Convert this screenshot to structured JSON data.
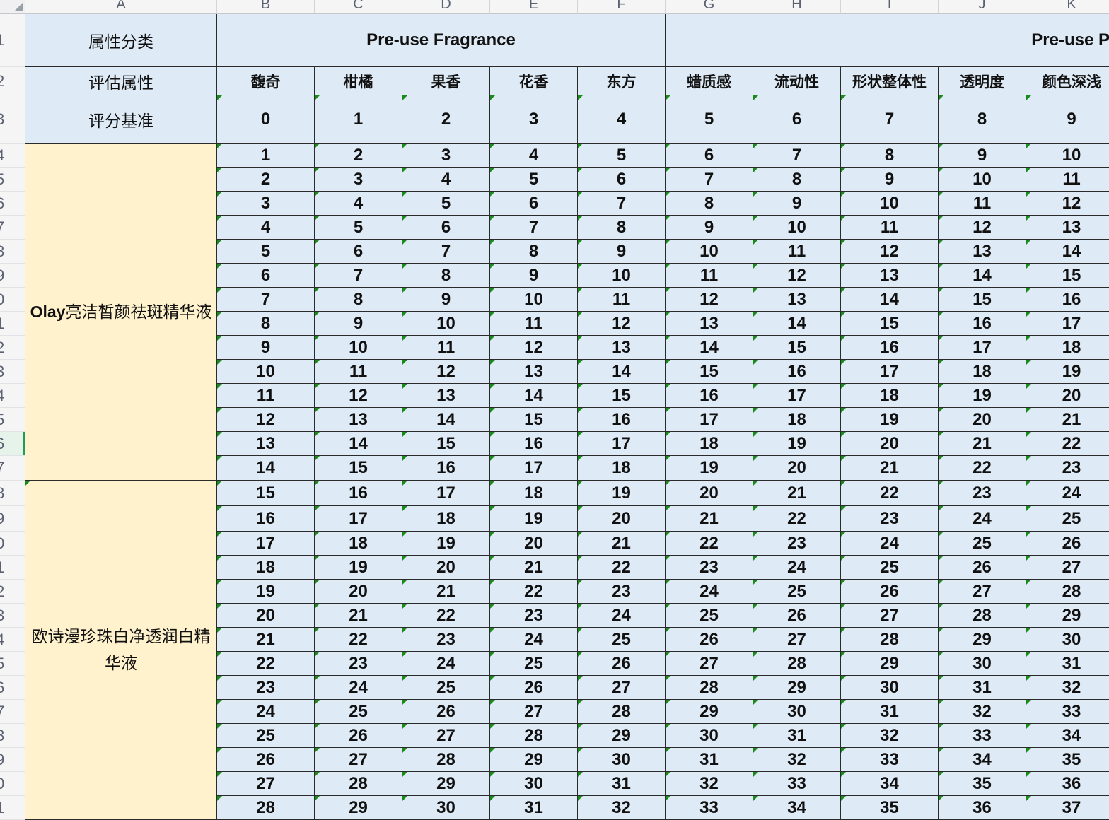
{
  "sheet": {
    "column_letters": [
      "A",
      "B",
      "C",
      "D",
      "E",
      "F",
      "G",
      "H",
      "I",
      "J",
      "K"
    ],
    "row_numbers": [
      "1",
      "2",
      "3",
      "4",
      "5",
      "6",
      "7",
      "8",
      "9",
      "0",
      "1",
      "2",
      "3",
      "4",
      "5",
      "6",
      "7",
      "8",
      "9",
      "0",
      "1",
      "2",
      "3",
      "4",
      "5",
      "6",
      "7",
      "8",
      "9",
      "0",
      "1"
    ],
    "selected_row_index": 15,
    "header_labels": {
      "category": "属性分类",
      "attribute": "评估属性",
      "baseline": "评分基准"
    },
    "categories": [
      "Pre-use Fragrance",
      "Pre-use P"
    ],
    "attributes": [
      "馥奇",
      "柑橘",
      "果香",
      "花香",
      "东方",
      "蜡质感",
      "流动性",
      "形状整体性",
      "透明度",
      "颜色深浅"
    ],
    "baseline_scores": [
      "0",
      "1",
      "2",
      "3",
      "4",
      "5",
      "6",
      "7",
      "8",
      "9"
    ],
    "products": [
      {
        "name_prefix": "Olay",
        "name_rest": "亮洁皙颜祛斑精华液",
        "row_start": 0,
        "row_count": 14
      },
      {
        "name_prefix": "",
        "name_rest": "欧诗漫珍珠白净透润白精华液",
        "row_start": 14,
        "row_count": 14
      }
    ],
    "rows": [
      [
        "1",
        "2",
        "3",
        "4",
        "5",
        "6",
        "7",
        "8",
        "9",
        "10"
      ],
      [
        "2",
        "3",
        "4",
        "5",
        "6",
        "7",
        "8",
        "9",
        "10",
        "11"
      ],
      [
        "3",
        "4",
        "5",
        "6",
        "7",
        "8",
        "9",
        "10",
        "11",
        "12"
      ],
      [
        "4",
        "5",
        "6",
        "7",
        "8",
        "9",
        "10",
        "11",
        "12",
        "13"
      ],
      [
        "5",
        "6",
        "7",
        "8",
        "9",
        "10",
        "11",
        "12",
        "13",
        "14"
      ],
      [
        "6",
        "7",
        "8",
        "9",
        "10",
        "11",
        "12",
        "13",
        "14",
        "15"
      ],
      [
        "7",
        "8",
        "9",
        "10",
        "11",
        "12",
        "13",
        "14",
        "15",
        "16"
      ],
      [
        "8",
        "9",
        "10",
        "11",
        "12",
        "13",
        "14",
        "15",
        "16",
        "17"
      ],
      [
        "9",
        "10",
        "11",
        "12",
        "13",
        "14",
        "15",
        "16",
        "17",
        "18"
      ],
      [
        "10",
        "11",
        "12",
        "13",
        "14",
        "15",
        "16",
        "17",
        "18",
        "19"
      ],
      [
        "11",
        "12",
        "13",
        "14",
        "15",
        "16",
        "17",
        "18",
        "19",
        "20"
      ],
      [
        "12",
        "13",
        "14",
        "15",
        "16",
        "17",
        "18",
        "19",
        "20",
        "21"
      ],
      [
        "13",
        "14",
        "15",
        "16",
        "17",
        "18",
        "19",
        "20",
        "21",
        "22"
      ],
      [
        "14",
        "15",
        "16",
        "17",
        "18",
        "19",
        "20",
        "21",
        "22",
        "23"
      ],
      [
        "15",
        "16",
        "17",
        "18",
        "19",
        "20",
        "21",
        "22",
        "23",
        "24"
      ],
      [
        "16",
        "17",
        "18",
        "19",
        "20",
        "21",
        "22",
        "23",
        "24",
        "25"
      ],
      [
        "17",
        "18",
        "19",
        "20",
        "21",
        "22",
        "23",
        "24",
        "25",
        "26"
      ],
      [
        "18",
        "19",
        "20",
        "21",
        "22",
        "23",
        "24",
        "25",
        "26",
        "27"
      ],
      [
        "19",
        "20",
        "21",
        "22",
        "23",
        "24",
        "25",
        "26",
        "27",
        "28"
      ],
      [
        "20",
        "21",
        "22",
        "23",
        "24",
        "25",
        "26",
        "27",
        "28",
        "29"
      ],
      [
        "21",
        "22",
        "23",
        "24",
        "25",
        "26",
        "27",
        "28",
        "29",
        "30"
      ],
      [
        "22",
        "23",
        "24",
        "25",
        "26",
        "27",
        "28",
        "29",
        "30",
        "31"
      ],
      [
        "23",
        "24",
        "25",
        "26",
        "27",
        "28",
        "29",
        "30",
        "31",
        "32"
      ],
      [
        "24",
        "25",
        "26",
        "27",
        "28",
        "29",
        "30",
        "31",
        "32",
        "33"
      ],
      [
        "25",
        "26",
        "27",
        "28",
        "29",
        "30",
        "31",
        "32",
        "33",
        "34"
      ],
      [
        "26",
        "27",
        "28",
        "29",
        "30",
        "31",
        "32",
        "33",
        "34",
        "35"
      ],
      [
        "27",
        "28",
        "29",
        "30",
        "31",
        "32",
        "33",
        "34",
        "35",
        "36"
      ],
      [
        "28",
        "29",
        "30",
        "31",
        "32",
        "33",
        "34",
        "35",
        "36",
        "37"
      ]
    ],
    "colors": {
      "header_fill": "#deeaf6",
      "product_fill": "#fff2cc",
      "note_marker": "#1a8a1a",
      "selection": "#1f9d55"
    }
  }
}
